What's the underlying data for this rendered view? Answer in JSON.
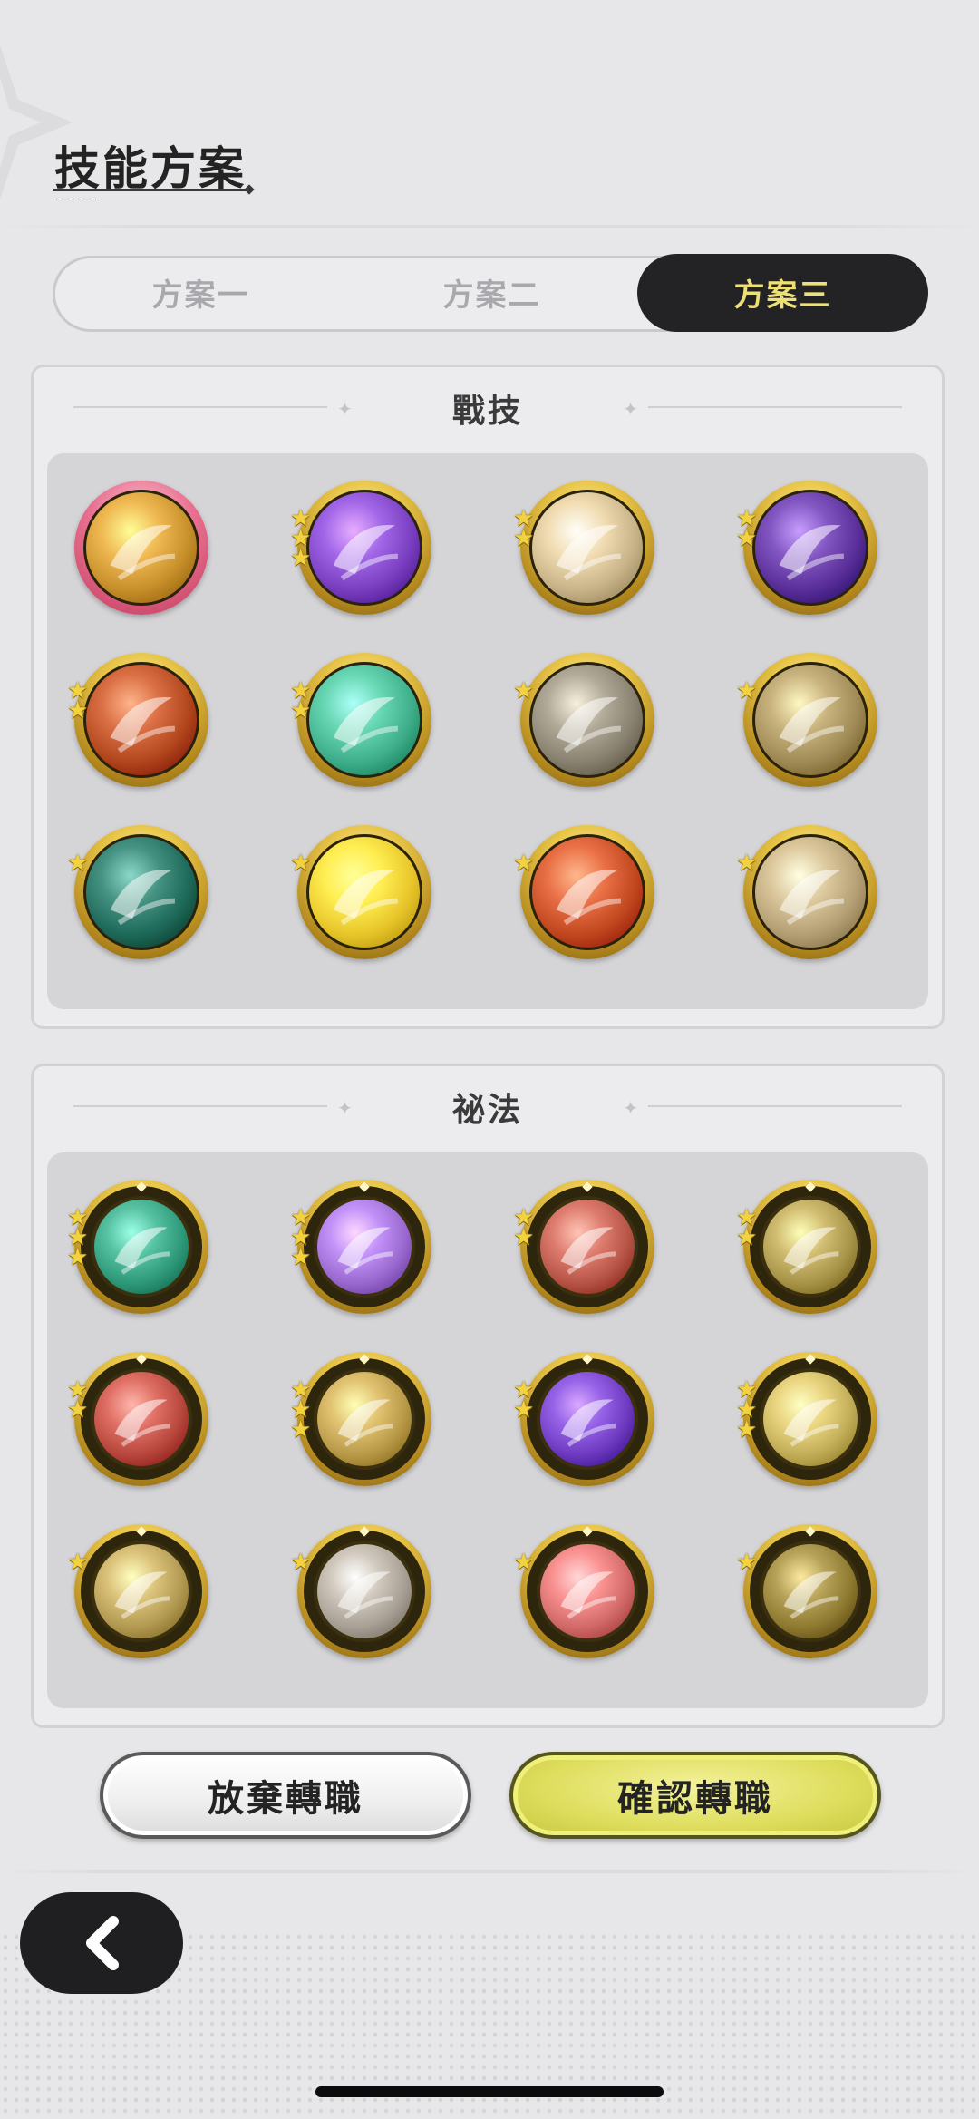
{
  "header": {
    "title": "技能方案"
  },
  "tabs": [
    {
      "label": "方案一",
      "active": false
    },
    {
      "label": "方案二",
      "active": false
    },
    {
      "label": "方案三",
      "active": true
    }
  ],
  "sections": {
    "combat": {
      "title": "戰技",
      "skills": [
        {
          "icon": "golden-swirl-skill-icon",
          "stars": 0,
          "selected": true,
          "color": "#c7902a"
        },
        {
          "icon": "purple-heart-skill-icon",
          "stars": 3,
          "color": "#7a3fc0"
        },
        {
          "icon": "light-burst-skill-icon",
          "stars": 2,
          "color": "#c9b48a"
        },
        {
          "icon": "shadow-grasp-skill-icon",
          "stars": 2,
          "color": "#5a2f9a"
        },
        {
          "icon": "flame-skill-icon",
          "stars": 2,
          "color": "#b2461c"
        },
        {
          "icon": "green-arrows-skill-icon",
          "stars": 2,
          "color": "#3fae8a"
        },
        {
          "icon": "wind-slash-skill-icon",
          "stars": 1,
          "color": "#8a8270"
        },
        {
          "icon": "golden-vortex-skill-icon",
          "stars": 1,
          "color": "#a08a55"
        },
        {
          "icon": "green-crescent-skill-icon",
          "stars": 1,
          "color": "#1e6a5a"
        },
        {
          "icon": "golden-shield-skill-icon",
          "stars": 1,
          "color": "#e8c62a"
        },
        {
          "icon": "fire-seal-skill-icon",
          "stars": 1,
          "color": "#c2491f"
        },
        {
          "icon": "hand-wave-skill-icon",
          "stars": 1,
          "color": "#b4a074"
        }
      ]
    },
    "mystic": {
      "title": "祕法",
      "skills": [
        {
          "icon": "green-heal-rune-icon",
          "stars": 3,
          "color": "#2f9a7a"
        },
        {
          "icon": "purple-orb-rune-icon",
          "stars": 3,
          "color": "#9a6ad0"
        },
        {
          "icon": "red-armor-rune-icon",
          "stars": 2,
          "color": "#b75648"
        },
        {
          "icon": "golden-figures-rune-icon",
          "stars": 2,
          "color": "#a9954a"
        },
        {
          "icon": "red-knight-rune-icon",
          "stars": 2,
          "color": "#b8483e"
        },
        {
          "icon": "golden-target-rune-icon",
          "stars": 3,
          "color": "#b89a48"
        },
        {
          "icon": "purple-flame-rune-icon",
          "stars": 2,
          "color": "#6d3ac0"
        },
        {
          "icon": "golden-guardian-rune-icon",
          "stars": 3,
          "color": "#c2ad58"
        },
        {
          "icon": "eye-rune-icon",
          "stars": 1,
          "color": "#b39a52"
        },
        {
          "icon": "blade-rune-icon",
          "stars": 1,
          "color": "#a8a094"
        },
        {
          "icon": "red-sword-rune-icon",
          "stars": 1,
          "color": "#d26a6a"
        },
        {
          "icon": "golden-spark-rune-icon",
          "stars": 1,
          "color": "#8e7a30"
        }
      ]
    }
  },
  "buttons": {
    "abandon": "放棄轉職",
    "confirm": "確認轉職"
  },
  "colors": {
    "accent": "#ece077",
    "dark": "#232325",
    "gold": "#e8c548"
  }
}
